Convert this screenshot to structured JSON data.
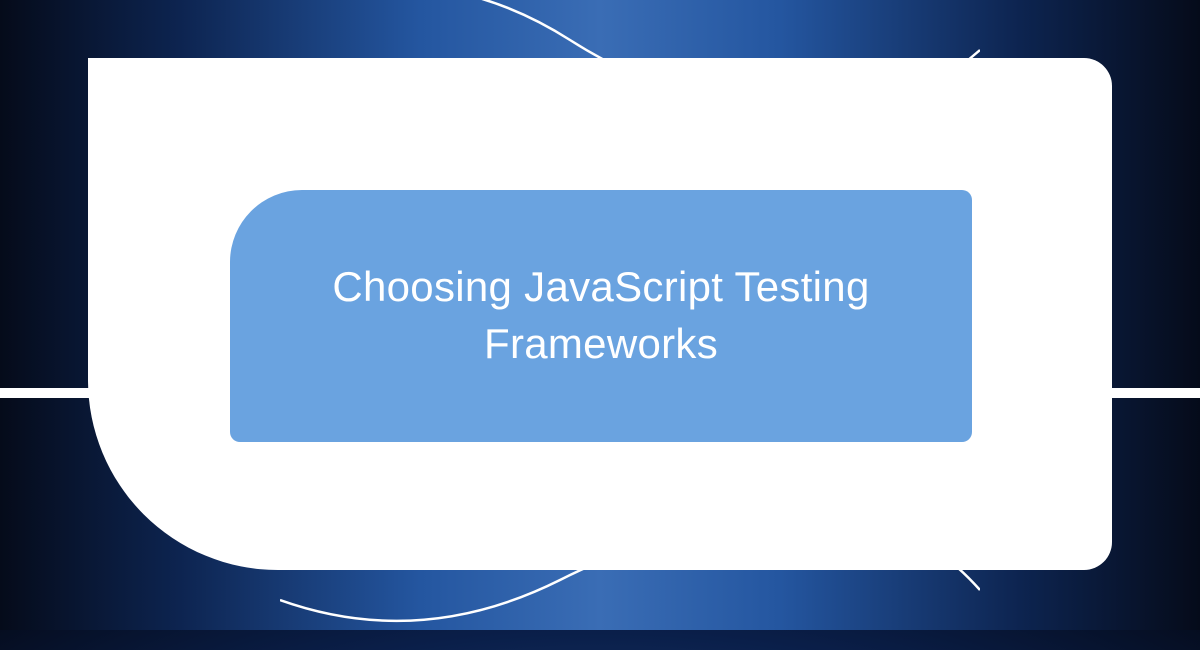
{
  "title": "Choosing JavaScript Testing Frameworks",
  "colors": {
    "inner_fill": "#6aa3e0",
    "outer_fill": "#ffffff",
    "text": "#ffffff"
  }
}
